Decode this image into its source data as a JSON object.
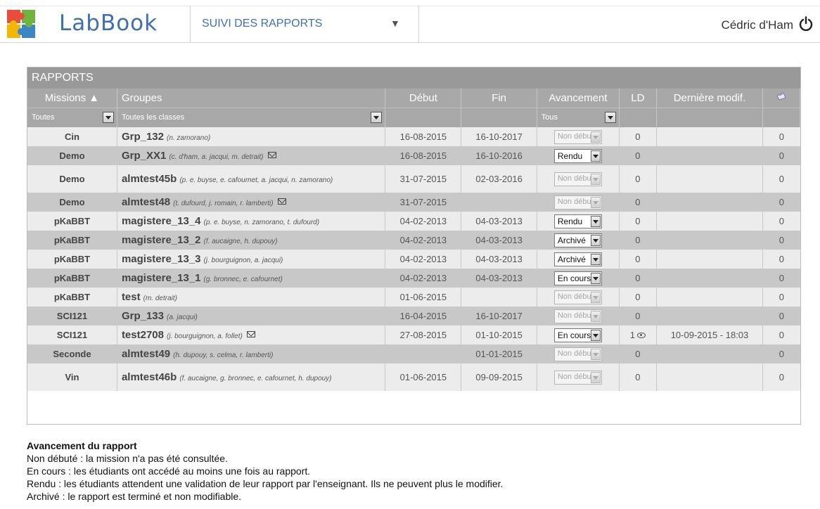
{
  "header": {
    "brand": "LabBook",
    "section_selector": "SUIVI DES RAPPORTS",
    "user": "Cédric d'Ham"
  },
  "panel": {
    "title": "RAPPORTS",
    "columns": {
      "missions": "Missions ▲",
      "groupes": "Groupes",
      "debut": "Début",
      "fin": "Fin",
      "avancement": "Avancement",
      "ld": "LD",
      "derniere_modif": "Dernière modif.",
      "messages_icon": "note-icon"
    },
    "filters": {
      "missions": "Toutes",
      "groupes": "Toutes les classes",
      "avancement": "Tous"
    },
    "rows": [
      {
        "mission": "Cin",
        "group": "Grp_132",
        "members": "(n. zamorano)",
        "mail": false,
        "debut": "16-08-2015",
        "fin": "16-10-2017",
        "status": "Non débuté",
        "disabled": true,
        "ld": "0",
        "eye": false,
        "modif": "",
        "msg": "0"
      },
      {
        "mission": "Demo",
        "group": "Grp_XX1",
        "members": "(c. d'ham, a. jacqui, m. detrait)",
        "mail": true,
        "debut": "16-08-2015",
        "fin": "16-10-2016",
        "status": "Rendu",
        "disabled": false,
        "ld": "0",
        "eye": false,
        "modif": "",
        "msg": "0"
      },
      {
        "mission": "Demo",
        "group": "almtest45b",
        "members": "(p. e. buyse, e. cafournet, a. jacqui, n. zamorano)",
        "mail": false,
        "debut": "31-07-2015",
        "fin": "02-03-2016",
        "status": "Non débuté",
        "disabled": true,
        "ld": "0",
        "eye": false,
        "modif": "",
        "msg": "0"
      },
      {
        "mission": "Demo",
        "group": "almtest48",
        "members": "(t. dufourd, j. romain, r. lamberti)",
        "mail": true,
        "debut": "31-07-2015",
        "fin": "",
        "status": "Non débuté",
        "disabled": true,
        "ld": "0",
        "eye": false,
        "modif": "",
        "msg": "0"
      },
      {
        "mission": "pKaBBT",
        "group": "magistere_13_4",
        "members": "(p. e. buyse, n. zamorano, t. dufourd)",
        "mail": false,
        "debut": "04-02-2013",
        "fin": "04-03-2013",
        "status": "Rendu",
        "disabled": false,
        "ld": "0",
        "eye": false,
        "modif": "",
        "msg": "0"
      },
      {
        "mission": "pKaBBT",
        "group": "magistere_13_2",
        "members": "(f. aucaigne, h. dupouy)",
        "mail": false,
        "debut": "04-02-2013",
        "fin": "04-03-2013",
        "status": "Archivé",
        "disabled": false,
        "ld": "0",
        "eye": false,
        "modif": "",
        "msg": "0"
      },
      {
        "mission": "pKaBBT",
        "group": "magistere_13_3",
        "members": "(j. bourguignon, a. jacqui)",
        "mail": false,
        "debut": "04-02-2013",
        "fin": "04-03-2013",
        "status": "Archivé",
        "disabled": false,
        "ld": "0",
        "eye": false,
        "modif": "",
        "msg": "0"
      },
      {
        "mission": "pKaBBT",
        "group": "magistere_13_1",
        "members": "(g. bronnec, e. cafournet)",
        "mail": false,
        "debut": "04-02-2013",
        "fin": "04-03-2013",
        "status": "En cours",
        "disabled": false,
        "ld": "0",
        "eye": false,
        "modif": "",
        "msg": "0"
      },
      {
        "mission": "pKaBBT",
        "group": "test",
        "members": "(m. detrait)",
        "mail": false,
        "debut": "01-06-2015",
        "fin": "",
        "status": "Non débuté",
        "disabled": true,
        "ld": "0",
        "eye": false,
        "modif": "",
        "msg": "0"
      },
      {
        "mission": "SCI121",
        "group": "Grp_133",
        "members": "(a. jacqui)",
        "mail": false,
        "debut": "16-04-2015",
        "fin": "16-10-2017",
        "status": "Non débuté",
        "disabled": true,
        "ld": "0",
        "eye": false,
        "modif": "",
        "msg": "0"
      },
      {
        "mission": "SCI121",
        "group": "test2708",
        "members": "(j. bourguignon, a. follet)",
        "mail": true,
        "debut": "27-08-2015",
        "fin": "01-10-2015",
        "status": "En cours",
        "disabled": false,
        "ld": "1",
        "eye": true,
        "modif": "10-09-2015 - 18:03",
        "msg": "0"
      },
      {
        "mission": "Seconde",
        "group": "almtest49",
        "members": "(h. dupouy, s. celma, r. lamberti)",
        "mail": false,
        "debut": "",
        "fin": "01-01-2015",
        "status": "Non débuté",
        "disabled": true,
        "ld": "0",
        "eye": false,
        "modif": "",
        "msg": "0"
      },
      {
        "mission": "Vin",
        "group": "almtest46b",
        "members": "(f. aucaigne, g. bronnec, e. cafournet, h. dupouy)",
        "mail": false,
        "debut": "01-06-2015",
        "fin": "09-09-2015",
        "status": "Non débuté",
        "disabled": true,
        "ld": "0",
        "eye": false,
        "modif": "",
        "msg": "0"
      }
    ]
  },
  "legend": {
    "title": "Avancement du rapport",
    "lines": [
      "Non débuté : la mission n'a pas été consultée.",
      "En cours : les étudiants ont accédé au moins une fois au rapport.",
      "Rendu : les étudiants attendent une validation de leur rapport par l'enseignant. Ils ne peuvent plus le modifier.",
      "Archivé : le rapport est terminé et non modifiable."
    ]
  },
  "colors": {
    "brand": "#3d6fb4",
    "header_bar": "#a8a8a8",
    "row_light": "#ececec",
    "row_dark": "#c8c8c8"
  }
}
